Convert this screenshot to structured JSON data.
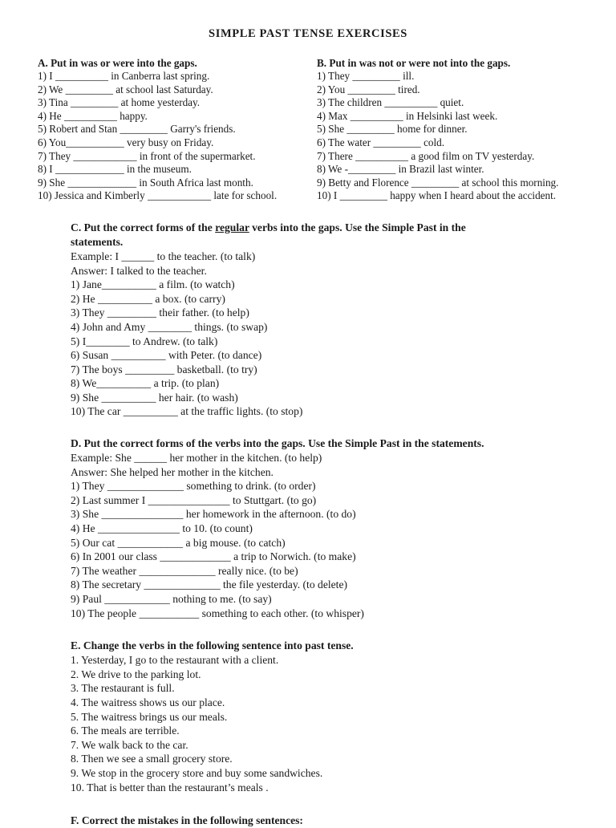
{
  "document": {
    "title": "SIMPLE PAST TENSE EXERCISES"
  },
  "section_a": {
    "heading": "A. Put in was or were into the gaps.",
    "items": [
      "1) I __________ in Canberra last spring.",
      "2) We _________ at school last Saturday.",
      "3) Tina _________  at home yesterday.",
      "4) He __________ happy.",
      "5) Robert and Stan  _________ Garry's friends.",
      "6) You___________  very busy on Friday.",
      "7) They ____________ in front of the supermarket.",
      "8) I _____________ in the museum.",
      "9) She _____________  in South Africa last month.",
      "10) Jessica and Kimberly  ____________ late for school."
    ]
  },
  "section_b": {
    "heading": "B. Put in was not or were not into the gaps.",
    "items": [
      "1) They _________ ill.",
      "2) You _________  tired.",
      "3) The children __________  quiet.",
      "4) Max __________  in Helsinki last week.",
      "5) She _________ home for dinner.",
      "6) The water _________ cold.",
      "7) There __________ a good film on TV yesterday.",
      "8) We -_________ in Brazil last winter.",
      "9) Betty and Florence _________  at school this morning.",
      "10) I _________  happy when I heard about the accident."
    ]
  },
  "section_c": {
    "heading_part1": "C. Put the correct forms of the ",
    "heading_underlined": "regular",
    "heading_part2": " verbs into the gaps. Use the Simple Past in the statements.",
    "example": "Example: I ______ to the teacher. (to talk)",
    "answer": "Answer: I talked to the teacher.",
    "items": [
      "1) Jane__________ a film. (to watch)",
      "2) He __________ a box. (to carry)",
      "3) They _________ their father. (to help)",
      "4) John and Amy ________ things. (to swap)",
      "5) I________ to Andrew. (to talk)",
      "6) Susan __________ with Peter. (to dance)",
      "7) The boys _________ basketball. (to try)",
      "8) We__________ a trip. (to plan)",
      "9) She __________ her hair. (to wash)",
      "10) The car __________ at the traffic lights. (to stop)"
    ]
  },
  "section_d": {
    "heading": "D. Put the correct forms of the verbs into the gaps. Use the Simple Past in the statements.",
    "example": "Example: She ______ her mother in the kitchen. (to help)",
    "answer": "Answer: She helped her mother in the kitchen.",
    "items": [
      "1) They ______________ something to drink. (to order)",
      "2) Last summer I _______________ to Stuttgart. (to go)",
      "3) She _______________ her homework in the afternoon. (to do)",
      "4) He _______________ to 10. (to count)",
      "5) Our cat ____________ a big mouse. (to catch)",
      "6) In 2001 our class _____________ a trip to Norwich. (to make)",
      "7) The weather ______________ really nice. (to be)",
      "8) The secretary ______________ the file yesterday. (to delete)",
      "9) Paul ____________ nothing to me. (to say)",
      "10) The people ___________ something to each other. (to whisper)"
    ]
  },
  "section_e": {
    "heading": "E. Change the verbs in the following sentence into past tense.",
    "items": [
      "1. Yesterday, I go to the restaurant with a client.",
      "2. We drive to the parking lot.",
      "3. The restaurant is full.",
      "4. The waitress shows us our place.",
      "5. The waitress brings us our meals.",
      "6. The meals are terrible.",
      "7. We walk back to the car.",
      "8. Then we see a small grocery store.",
      "9. We stop in the grocery store and buy some sandwiches.",
      "10. That is better than the restaurant’s meals ."
    ]
  },
  "section_f": {
    "heading": "F. Correct the mistakes in the following sentences:"
  }
}
